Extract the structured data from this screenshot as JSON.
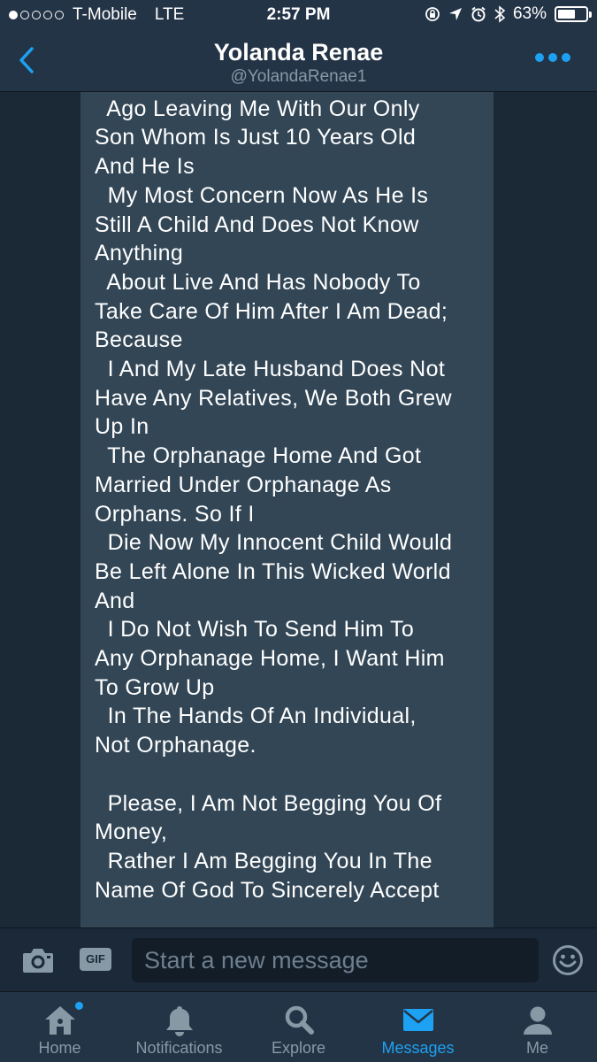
{
  "status_bar": {
    "carrier": "T-Mobile",
    "network": "LTE",
    "time": "2:57 PM",
    "battery": "63%",
    "battery_level": 0.63
  },
  "nav": {
    "title": "Yolanda Renae",
    "handle": "@YolandaRenae1"
  },
  "message": {
    "text": "Few Years\n  Ago Leaving Me With Our Only\nSon Whom Is Just 10 Years Old\nAnd He Is\n  My Most Concern Now As He Is\nStill A Child And Does Not Know\nAnything\n  About Live And Has Nobody To\nTake Care Of Him After I Am Dead;\nBecause\n  I And My Late Husband Does Not\nHave Any Relatives, We Both Grew\nUp In\n  The Orphanage Home And Got\nMarried Under Orphanage As\nOrphans. So If I\n  Die Now My Innocent Child Would\nBe Left Alone In This Wicked World\nAnd\n  I Do Not Wish To Send Him To\nAny Orphanage Home, I Want Him\nTo Grow Up\n  In The Hands Of An Individual,\nNot Orphanage.\n\n  Please, I Am Not Begging You Of\nMoney,\n  Rather I Am Begging You In The\nName Of God To Sincerely Accept"
  },
  "composer": {
    "gif_label": "GIF",
    "placeholder": "Start a new message"
  },
  "tabs": [
    {
      "label": "Home",
      "icon": "home-icon"
    },
    {
      "label": "Notifications",
      "icon": "bell-icon"
    },
    {
      "label": "Explore",
      "icon": "search-icon"
    },
    {
      "label": "Messages",
      "icon": "envelope-icon"
    },
    {
      "label": "Me",
      "icon": "person-icon"
    }
  ],
  "colors": {
    "accent": "#1da1f2",
    "header_bg": "#243447",
    "bubble_bg": "#324656",
    "muted": "#8899a6"
  }
}
